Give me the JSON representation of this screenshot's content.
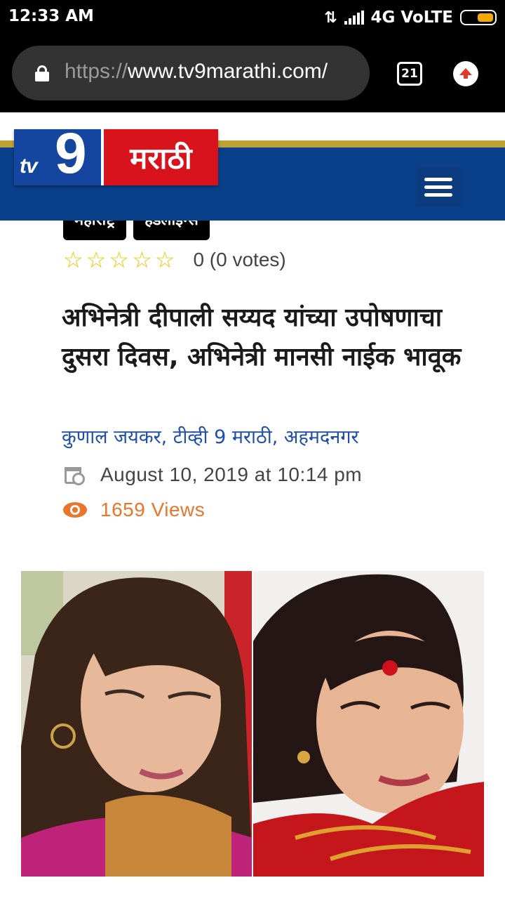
{
  "status_bar": {
    "time": "12:33 AM",
    "network": "4G VoLTE"
  },
  "browser": {
    "url_scheme": "https://",
    "url_host": "www.tv9marathi.com/",
    "tab_count": "21"
  },
  "site": {
    "logo_tv": "tv",
    "logo_nine": "9",
    "logo_text": "मराठी",
    "colors": {
      "blue": "#0a3f8a",
      "gold": "#bfa236",
      "red": "#d8131b"
    }
  },
  "article": {
    "tags": [
      "महाराष्ट्र",
      "हेडलाइन्स"
    ],
    "rating_text": "0 (0 votes)",
    "headline": "अभिनेत्री दीपाली सय्यद यांच्या उपोषणाचा दुसरा दिवस, अभिनेत्री मानसी नाईक भावूक",
    "author": "कुणाल जयकर, टीव्ही 9 मराठी, अहमदनगर",
    "date": "August 10, 2019 at 10:14 pm",
    "views": "1659 Views"
  }
}
